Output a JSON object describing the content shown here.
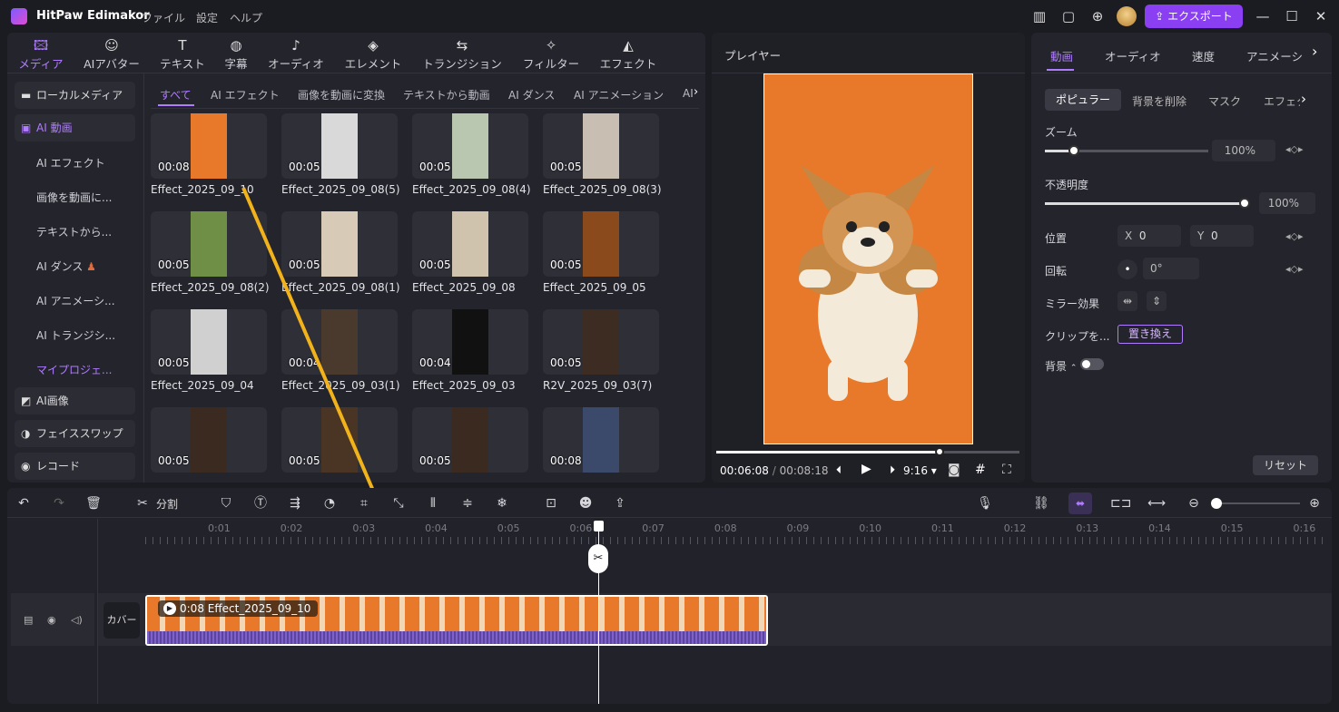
{
  "app": {
    "title": "HitPaw Edimakor",
    "menu": [
      "ファイル",
      "設定",
      "ヘルプ"
    ],
    "export_label": "エクスポート"
  },
  "toolbar_tabs": [
    {
      "label": "メディア",
      "icon": "media-icon"
    },
    {
      "label": "AIアバター",
      "icon": "avatar-icon"
    },
    {
      "label": "テキスト",
      "icon": "text-icon"
    },
    {
      "label": "字幕",
      "icon": "subtitle-icon"
    },
    {
      "label": "オーディオ",
      "icon": "audio-icon"
    },
    {
      "label": "エレメント",
      "icon": "element-icon"
    },
    {
      "label": "トランジション",
      "icon": "transition-icon"
    },
    {
      "label": "フィルター",
      "icon": "filter-icon"
    },
    {
      "label": "エフェクト",
      "icon": "effect-icon"
    }
  ],
  "sidebar": {
    "local_media": "ローカルメディア",
    "ai_video": "AI 動画",
    "sub_items": [
      "AI エフェクト",
      "画像を動画に...",
      "テキストから...",
      "AI ダンス",
      "AI アニメーシ...",
      "AI トランジシ...",
      "マイプロジェ..."
    ],
    "ai_image": "AI画像",
    "face_swap": "フェイススワップ",
    "record": "レコード"
  },
  "media_tabs": [
    "すべて",
    "AI エフェクト",
    "画像を動画に変換",
    "テキストから動画",
    "AI ダンス",
    "AI アニメーション",
    "AI"
  ],
  "media": [
    {
      "name": "Effect_2025_09_10",
      "duration": "00:08",
      "thumb": "#e8792a"
    },
    {
      "name": "Effect_2025_09_08(5)",
      "duration": "00:05",
      "thumb": "#d9d9d9"
    },
    {
      "name": "Effect_2025_09_08(4)",
      "duration": "00:05",
      "thumb": "#b9c7b0"
    },
    {
      "name": "Effect_2025_09_08(3)",
      "duration": "00:05",
      "thumb": "#c8beb2"
    },
    {
      "name": "Effect_2025_09_08(2)",
      "duration": "00:05",
      "thumb": "#6f8f47"
    },
    {
      "name": "Effect_2025_09_08(1)",
      "duration": "00:05",
      "thumb": "#d7cbb8"
    },
    {
      "name": "Effect_2025_09_08",
      "duration": "00:05",
      "thumb": "#cfc3ad"
    },
    {
      "name": "Effect_2025_09_05",
      "duration": "00:05",
      "thumb": "#8a4a1c"
    },
    {
      "name": "Effect_2025_09_04",
      "duration": "00:05",
      "thumb": "#d0d0d0"
    },
    {
      "name": "Effect_2025_09_03(1)",
      "duration": "00:04",
      "thumb": "#4a3a2e"
    },
    {
      "name": "Effect_2025_09_03",
      "duration": "00:04",
      "thumb": "#111111"
    },
    {
      "name": "R2V_2025_09_03(7)",
      "duration": "00:05",
      "thumb": "#3c2c22"
    },
    {
      "name": "",
      "duration": "00:05",
      "thumb": "#3a2a1f"
    },
    {
      "name": "",
      "duration": "00:05",
      "thumb": "#4a3424"
    },
    {
      "name": "",
      "duration": "00:05",
      "thumb": "#3a2a20"
    },
    {
      "name": "",
      "duration": "00:08",
      "thumb": "#3b4a6a"
    }
  ],
  "player": {
    "title": "プレイヤー",
    "current": "00:06:08",
    "separator": "/",
    "total": "00:08:18",
    "ratio": "9:16",
    "progress": 0.74
  },
  "right_tabs": [
    "動画",
    "オーディオ",
    "速度",
    "アニメーシ"
  ],
  "right_subtabs": [
    "ポピュラー",
    "背景を削除",
    "マスク",
    "エフェク"
  ],
  "props": {
    "zoom_label": "ズーム",
    "zoom_value": "100%",
    "zoom_level": 0.18,
    "opacity_label": "不透明度",
    "opacity_value": "100%",
    "opacity_level": 1.0,
    "position_label": "位置",
    "x_label": "X",
    "x_value": "0",
    "y_label": "Y",
    "y_value": "0",
    "rotation_label": "回転",
    "rotation_value": "0°",
    "mirror_label": "ミラー効果",
    "clip_label": "クリップを...",
    "replace_label": "置き換え",
    "background_label": "背景",
    "reset_label": "リセット"
  },
  "timeline": {
    "split_label": "分割",
    "ticks": [
      "0:01",
      "0:02",
      "0:03",
      "0:04",
      "0:05",
      "0:06",
      "0:07",
      "0:08",
      "0:09",
      "0:10",
      "0:11",
      "0:12",
      "0:13",
      "0:14",
      "0:15",
      "0:16"
    ],
    "clip_label": "0:08 Effect_2025_09_10",
    "cover_label": "カバー"
  }
}
